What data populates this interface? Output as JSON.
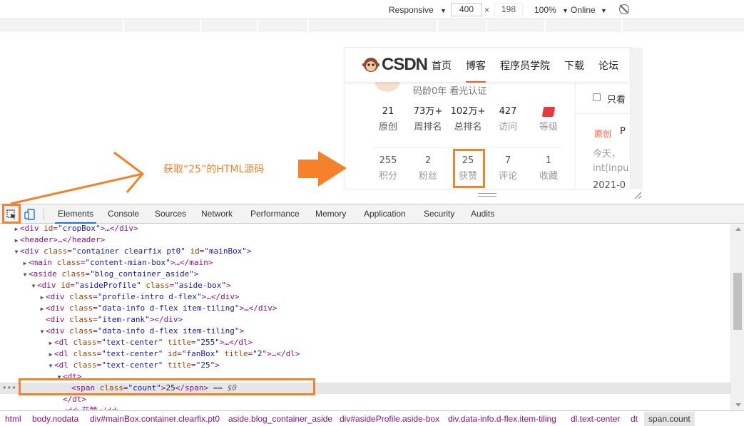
{
  "device_toolbar": {
    "responsive": "Responsive",
    "width": "400",
    "times": "×",
    "height": "198",
    "zoom": "100%",
    "network": "Online",
    "caret": "▼"
  },
  "csdn": {
    "logo_text": "CSDN",
    "nav": [
      "首页",
      "博客",
      "程序员学院",
      "下载",
      "论坛"
    ],
    "profile_line": "码龄0年    看光认证",
    "stats_row1": [
      {
        "value": "21",
        "label": "原创"
      },
      {
        "value": "73万+",
        "label": "周排名"
      },
      {
        "value": "102万+",
        "label": "总排名"
      },
      {
        "value": "427",
        "label": "访问"
      },
      {
        "value": "",
        "label": "等级"
      }
    ],
    "stats_row2": [
      {
        "value": "255",
        "label": "积分"
      },
      {
        "value": "2",
        "label": "粉丝"
      },
      {
        "value": "25",
        "label": "获赞"
      },
      {
        "value": "7",
        "label": "评论"
      },
      {
        "value": "1",
        "label": "收藏"
      }
    ],
    "right_panel": {
      "only_see": "只看",
      "badge": "原创",
      "badge_r": "P",
      "line1": "今天，",
      "line2": "int(inpu",
      "line3": "2021-0"
    }
  },
  "annotation": {
    "text": "获取“25”的HTML源码"
  },
  "devtools": {
    "tabs": [
      "Elements",
      "Console",
      "Sources",
      "Network",
      "Performance",
      "Memory",
      "Application",
      "Security",
      "Audits"
    ],
    "active_tab": "Elements",
    "dom": [
      {
        "indent": 30,
        "tri": "▶",
        "tag_open": "<div",
        "attrs": [
          {
            "n": "id",
            "v": "cropBox"
          }
        ],
        "rest": ">…</div>"
      },
      {
        "indent": 30,
        "tri": "▶",
        "tag_open": "<header",
        "attrs": [],
        "rest": ">…</header>"
      },
      {
        "indent": 30,
        "tri": "▼",
        "tag_open": "<div",
        "attrs": [
          {
            "n": "class",
            "v": "container clearfix pt0"
          },
          {
            "n": "id",
            "v": "mainBox"
          }
        ],
        "rest": ">"
      },
      {
        "indent": 42,
        "tri": "▶",
        "tag_open": "<main",
        "attrs": [
          {
            "n": "class",
            "v": "content-mian-box"
          }
        ],
        "rest": ">…</main>"
      },
      {
        "indent": 42,
        "tri": "▼",
        "tag_open": "<aside",
        "attrs": [
          {
            "n": "class",
            "v": "blog_container_aside"
          }
        ],
        "rest": ">"
      },
      {
        "indent": 54,
        "tri": "▼",
        "tag_open": "<div",
        "attrs": [
          {
            "n": "id",
            "v": "asideProfile"
          },
          {
            "n": "class",
            "v": "aside-box"
          }
        ],
        "rest": ">"
      },
      {
        "indent": 66,
        "tri": "▶",
        "tag_open": "<div",
        "attrs": [
          {
            "n": "class",
            "v": "profile-intro d-flex"
          }
        ],
        "rest": ">…</div>"
      },
      {
        "indent": 66,
        "tri": "▶",
        "tag_open": "<div",
        "attrs": [
          {
            "n": "class",
            "v": "data-info d-flex item-tiling"
          }
        ],
        "rest": ">…</div>"
      },
      {
        "indent": 66,
        "tri": "",
        "tag_open": "<div",
        "attrs": [
          {
            "n": "class",
            "v": "item-rank"
          }
        ],
        "rest": "></div>"
      },
      {
        "indent": 66,
        "tri": "▼",
        "tag_open": "<div",
        "attrs": [
          {
            "n": "class",
            "v": "data-info d-flex item-tiling"
          }
        ],
        "rest": ">"
      },
      {
        "indent": 78,
        "tri": "▶",
        "tag_open": "<dl",
        "attrs": [
          {
            "n": "class",
            "v": "text-center"
          },
          {
            "n": "title",
            "v": "255"
          }
        ],
        "rest": ">…</dl>"
      },
      {
        "indent": 78,
        "tri": "▶",
        "tag_open": "<dl",
        "attrs": [
          {
            "n": "class",
            "v": "text-center"
          },
          {
            "n": "id",
            "v": "fanBox"
          },
          {
            "n": "title",
            "v": "2"
          }
        ],
        "rest": ">…</dl>"
      },
      {
        "indent": 78,
        "tri": "▼",
        "tag_open": "<dl",
        "attrs": [
          {
            "n": "class",
            "v": "text-center"
          },
          {
            "n": "title",
            "v": "25"
          }
        ],
        "rest": ">"
      },
      {
        "indent": 90,
        "tri": "▼",
        "tag_open": "<dt",
        "attrs": [],
        "rest": ">"
      },
      {
        "indent": 102,
        "tri": "",
        "tag_open": "<span",
        "attrs": [
          {
            "n": "class",
            "v": "count"
          }
        ],
        "rest": ">",
        "text": "25",
        "close": "</span>",
        "suffix": " == $0",
        "selected": true
      },
      {
        "indent": 90,
        "tri": "",
        "tag_open": "</dt",
        "attrs": [],
        "rest": ">"
      },
      {
        "indent": 90,
        "tri": "▶",
        "tag_open": "<dd",
        "attrs": [],
        "rest": ">获赞</dd>"
      }
    ],
    "breadcrumbs": [
      "html",
      "body.nodata",
      "div#mainBox.container.clearfix.pt0",
      "aside.blog_container_aside",
      "div#asideProfile.aside-box",
      "div.data-info.d-flex.item-tiling",
      "dl.text-center",
      "dt",
      "span.count"
    ]
  },
  "colors": {
    "accent": "#f5822b",
    "csdn_red": "#fc5531",
    "tag": "#881280",
    "attr": "#994500",
    "value": "#1a1aa6"
  }
}
